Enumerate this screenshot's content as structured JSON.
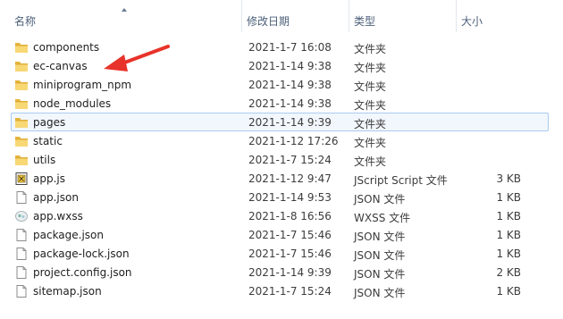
{
  "columns": {
    "name": "名称",
    "date": "修改日期",
    "type": "类型",
    "size": "大小"
  },
  "files": [
    {
      "name": "components",
      "date": "2021-1-7 16:08",
      "type": "文件夹",
      "size": "",
      "icon": "folder-icon"
    },
    {
      "name": "ec-canvas",
      "date": "2021-1-14 9:38",
      "type": "文件夹",
      "size": "",
      "icon": "folder-icon"
    },
    {
      "name": "miniprogram_npm",
      "date": "2021-1-14 9:38",
      "type": "文件夹",
      "size": "",
      "icon": "folder-icon"
    },
    {
      "name": "node_modules",
      "date": "2021-1-14 9:38",
      "type": "文件夹",
      "size": "",
      "icon": "folder-icon"
    },
    {
      "name": "pages",
      "date": "2021-1-14 9:39",
      "type": "文件夹",
      "size": "",
      "icon": "folder-icon",
      "selected": true
    },
    {
      "name": "static",
      "date": "2021-1-12 17:26",
      "type": "文件夹",
      "size": "",
      "icon": "folder-icon"
    },
    {
      "name": "utils",
      "date": "2021-1-7 15:24",
      "type": "文件夹",
      "size": "",
      "icon": "folder-icon"
    },
    {
      "name": "app.js",
      "date": "2021-1-12 9:47",
      "type": "JScript Script 文件",
      "size": "3 KB",
      "icon": "script-icon"
    },
    {
      "name": "app.json",
      "date": "2021-1-14 9:53",
      "type": "JSON 文件",
      "size": "1 KB",
      "icon": "document-icon"
    },
    {
      "name": "app.wxss",
      "date": "2021-1-8 16:56",
      "type": "WXSS 文件",
      "size": "1 KB",
      "icon": "wxss-icon"
    },
    {
      "name": "package.json",
      "date": "2021-1-7 15:46",
      "type": "JSON 文件",
      "size": "1 KB",
      "icon": "document-icon"
    },
    {
      "name": "package-lock.json",
      "date": "2021-1-7 15:46",
      "type": "JSON 文件",
      "size": "1 KB",
      "icon": "document-icon"
    },
    {
      "name": "project.config.json",
      "date": "2021-1-14 9:39",
      "type": "JSON 文件",
      "size": "2 KB",
      "icon": "document-icon"
    },
    {
      "name": "sitemap.json",
      "date": "2021-1-7 15:24",
      "type": "JSON 文件",
      "size": "1 KB",
      "icon": "document-icon"
    }
  ],
  "annotation": {
    "color": "#e8332a",
    "icon": "red-arrow"
  }
}
